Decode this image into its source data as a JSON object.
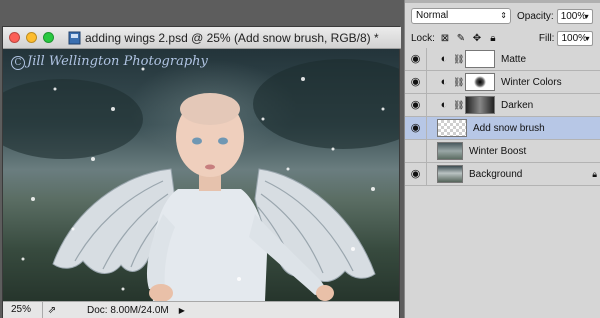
{
  "document": {
    "title": "adding wings 2.psd @ 25% (Add snow brush, RGB/8) *",
    "watermark": "Jill Wellington Photography",
    "watermark_symbol": "C"
  },
  "statusbar": {
    "zoom": "25%",
    "doc_info": "Doc: 8.00M/24.0M"
  },
  "layers_panel": {
    "blend_mode": "Normal",
    "opacity_label": "Opacity:",
    "opacity_value": "100%",
    "lock_label": "Lock:",
    "fill_label": "Fill:",
    "fill_value": "100%",
    "layers": [
      {
        "name": "Matte",
        "visible": true
      },
      {
        "name": "Winter Colors",
        "visible": true
      },
      {
        "name": "Darken",
        "visible": true
      },
      {
        "name": "Add snow brush",
        "visible": true,
        "selected": true
      },
      {
        "name": "Winter Boost",
        "visible": false
      },
      {
        "name": "Background",
        "visible": true,
        "locked": true
      }
    ]
  },
  "colors": {
    "selected_layer": "#b7c7e6",
    "panel_bg": "#d6d6d6"
  }
}
